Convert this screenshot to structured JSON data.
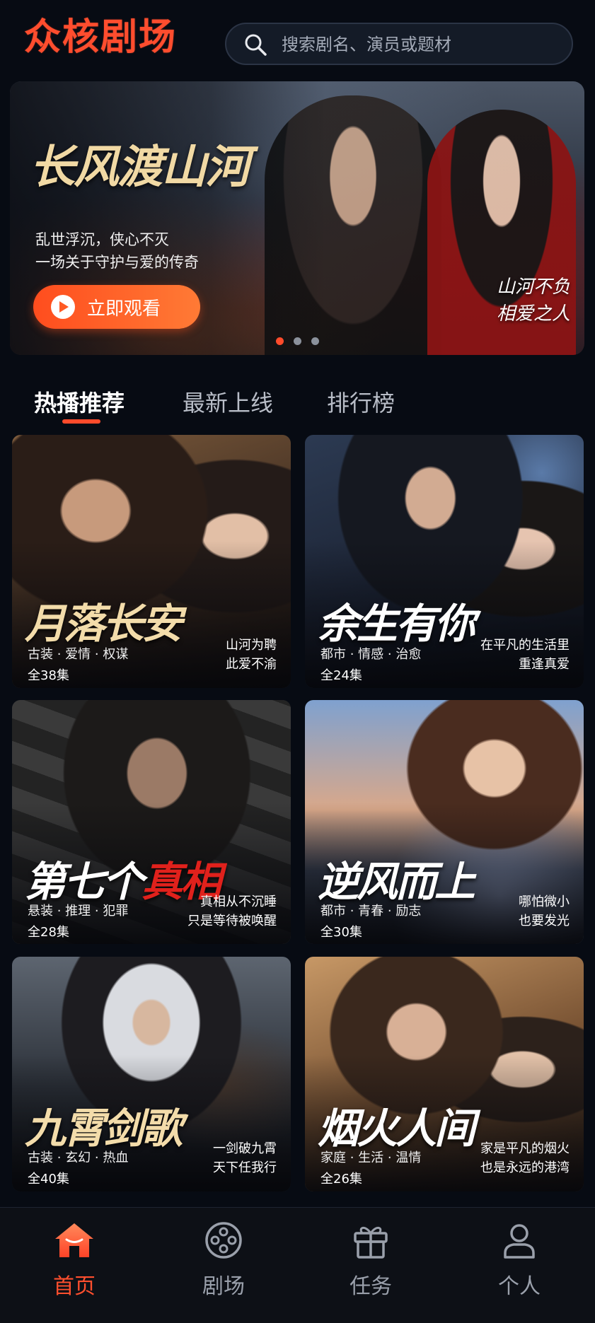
{
  "header": {
    "logo": "众核剧场",
    "search_placeholder": "搜索剧名、演员或题材"
  },
  "banner": {
    "title": "长风渡山河",
    "line1": "乱世浮沉，侠心不灭",
    "line2": "一场关于守护与爱的传奇",
    "watch_label": "立即观看",
    "corner_line1": "山河不负",
    "corner_line2": "相爱之人",
    "dots_total": 3,
    "dots_active": 1
  },
  "tabs": [
    {
      "label": "热播推荐",
      "active": true
    },
    {
      "label": "最新上线",
      "active": false
    },
    {
      "label": "排行榜",
      "active": false
    }
  ],
  "cards": [
    {
      "title": "月落长安",
      "tags": "古装 · 爱情 · 权谋",
      "episodes": "全38集",
      "quote1": "山河为聘",
      "quote2": "此爱不渝"
    },
    {
      "title": "余生有你",
      "tags": "都市 · 情感 · 治愈",
      "episodes": "全24集",
      "quote1": "在平凡的生活里",
      "quote2": "重逢真爱"
    },
    {
      "title_a": "第七个",
      "title_b": "真相",
      "tags": "悬装 · 推理 · 犯罪",
      "episodes": "全28集",
      "quote1": "真相从不沉睡",
      "quote2": "只是等待被唤醒"
    },
    {
      "title": "逆风而上",
      "tags": "都市 · 青春 · 励志",
      "episodes": "全30集",
      "quote1": "哪怕微小",
      "quote2": "也要发光"
    },
    {
      "title": "九霄剑歌",
      "tags": "古装 · 玄幻 · 热血",
      "episodes": "全40集",
      "quote1": "一剑破九霄",
      "quote2": "天下任我行"
    },
    {
      "title": "烟火人间",
      "tags": "家庭 · 生活 · 温情",
      "episodes": "全26集",
      "quote1": "家是平凡的烟火",
      "quote2": "也是永远的港湾"
    }
  ],
  "nav": [
    {
      "label": "首页",
      "icon": "home-icon",
      "active": true
    },
    {
      "label": "剧场",
      "icon": "film-reel-icon",
      "active": false
    },
    {
      "label": "任务",
      "icon": "gift-icon",
      "active": false
    },
    {
      "label": "个人",
      "icon": "person-icon",
      "active": false
    }
  ],
  "colors": {
    "accent": "#ff4b2b",
    "background": "#070b13"
  }
}
